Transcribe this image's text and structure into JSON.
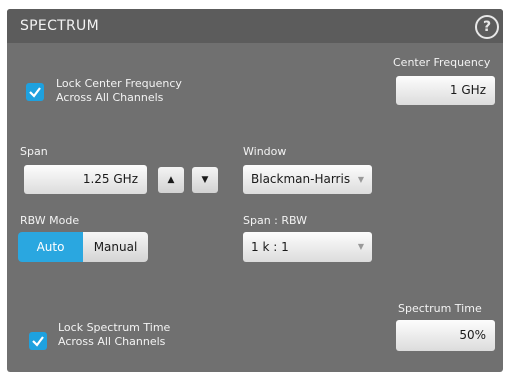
{
  "title": "SPECTRUM",
  "help_glyph": "?",
  "lock_center": {
    "line1": "Lock Center Frequency",
    "line2": "Across All Channels",
    "checked": true
  },
  "center_frequency": {
    "label": "Center Frequency",
    "value": "1 GHz"
  },
  "span": {
    "label": "Span",
    "value": "1.25 GHz",
    "up_glyph": "▲",
    "down_glyph": "▼"
  },
  "window": {
    "label": "Window",
    "value": "Blackman-Harris",
    "arrow_glyph": "▼"
  },
  "rbw_mode": {
    "label": "RBW Mode",
    "options": [
      "Auto",
      "Manual"
    ],
    "selected": "Auto"
  },
  "span_rbw": {
    "label": "Span : RBW",
    "value": "1 k : 1",
    "arrow_glyph": "▼"
  },
  "lock_spectrum": {
    "line1": "Lock Spectrum Time",
    "line2": "Across All Channels",
    "checked": true
  },
  "spectrum_time": {
    "label": "Spectrum Time",
    "value": "50%"
  },
  "colors": {
    "accent": "#2aa7e0",
    "panel": "#707070",
    "header": "#5c5c5c"
  },
  "icons": {
    "help": "help-icon",
    "check": "check-icon",
    "up": "chevron-up-icon",
    "down": "chevron-down-icon"
  }
}
